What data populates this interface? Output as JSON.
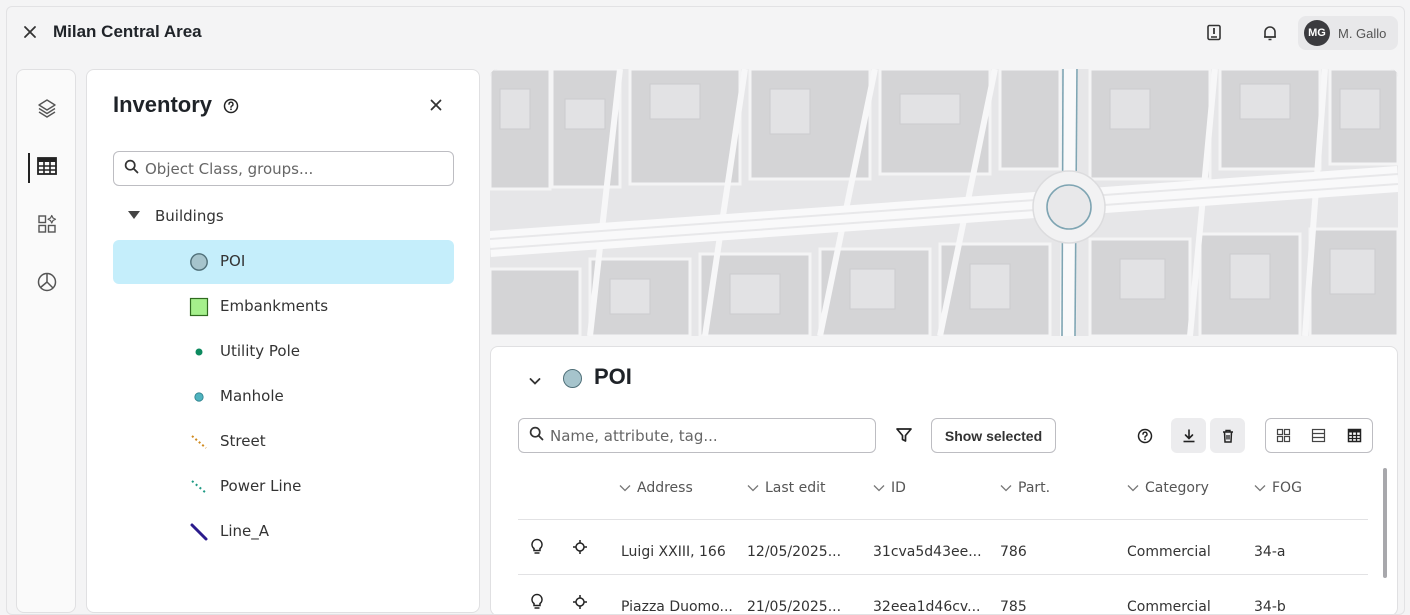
{
  "header": {
    "title": "Milan Central Area",
    "user_initials": "MG",
    "user_name": "M. Gallo"
  },
  "rail": {
    "items": [
      "layers-icon",
      "table-icon",
      "widgets-icon",
      "chart-pie-icon"
    ],
    "active_index": 1
  },
  "inventory": {
    "title": "Inventory",
    "search_placeholder": "Object Class, groups...",
    "group": "Buildings",
    "items": [
      {
        "label": "POI",
        "icon": "poi-circle-icon",
        "selected": true
      },
      {
        "label": "Embankments",
        "icon": "embankment-square-icon"
      },
      {
        "label": "Utility Pole",
        "icon": "utility-pole-dot-icon"
      },
      {
        "label": "Manhole",
        "icon": "manhole-dot-icon"
      },
      {
        "label": "Street",
        "icon": "street-line-icon"
      },
      {
        "label": "Power Line",
        "icon": "power-line-icon"
      },
      {
        "label": "Line_A",
        "icon": "line-a-icon"
      }
    ]
  },
  "poi": {
    "title": "POI",
    "search_placeholder": "Name, attribute, tag...",
    "show_selected_label": "Show selected",
    "columns": [
      "Address",
      "Last edit",
      "ID",
      "Part.",
      "Category",
      "FOG"
    ],
    "rows": [
      {
        "address": "Luigi XXIII, 166",
        "last_edit": "12/05/2025...",
        "id": "31cva5d43ee...",
        "part": "786",
        "category": "Commercial",
        "fog": "34-a"
      },
      {
        "address": "Piazza Duomo...",
        "last_edit": "21/05/2025...",
        "id": "32eea1d46cv...",
        "part": "785",
        "category": "Commercial",
        "fog": "34-b"
      }
    ]
  },
  "colors": {
    "selection": "#c5eefb",
    "poi_fill": "#a6c4cc",
    "embankment_fill": "#a5f08c",
    "utility_pole": "#0d8a5f",
    "manhole": "#4fb3bf",
    "street": "#d08a1e",
    "power_line": "#1f9a84",
    "line_a": "#2b1b8c"
  }
}
